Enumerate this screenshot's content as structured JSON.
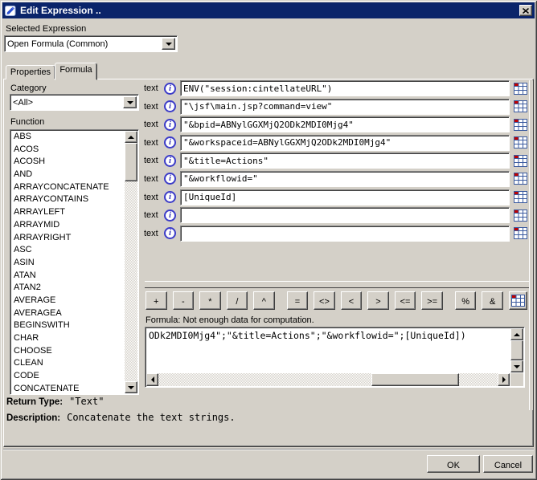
{
  "window": {
    "title": "Edit Expression .."
  },
  "selected_expression": {
    "label": "Selected Expression",
    "value": "Open Formula (Common)"
  },
  "tabs": {
    "properties": "Properties",
    "formula": "Formula"
  },
  "category": {
    "label": "Category",
    "value": "<All>"
  },
  "functions": {
    "label": "Function",
    "items": [
      "ABS",
      "ACOS",
      "ACOSH",
      "AND",
      "ARRAYCONCATENATE",
      "ARRAYCONTAINS",
      "ARRAYLEFT",
      "ARRAYMID",
      "ARRAYRIGHT",
      "ASC",
      "ASIN",
      "ATAN",
      "ATAN2",
      "AVERAGE",
      "AVERAGEA",
      "BEGINSWITH",
      "CHAR",
      "CHOOSE",
      "CLEAN",
      "CODE",
      "CONCATENATE"
    ]
  },
  "rows": [
    {
      "label": "text",
      "value": "ENV(\"session:cintellateURL\")"
    },
    {
      "label": "text",
      "value": "\"\\jsf\\main.jsp?command=view\""
    },
    {
      "label": "text",
      "value": "\"&bpid=ABNylGGXMjQ2ODk2MDI0Mjg4\""
    },
    {
      "label": "text",
      "value": "\"&workspaceid=ABNylGGXMjQ2ODk2MDI0Mjg4\""
    },
    {
      "label": "text",
      "value": "\"&title=Actions\""
    },
    {
      "label": "text",
      "value": "\"&workflowid=\""
    },
    {
      "label": "text",
      "value": "[UniqueId]"
    },
    {
      "label": "text",
      "value": ""
    },
    {
      "label": "text",
      "value": ""
    }
  ],
  "operators": [
    [
      "+",
      "-",
      "*",
      "/",
      "^"
    ],
    [
      "=",
      "<>",
      "<",
      ">",
      "<=",
      ">="
    ],
    [
      "%",
      "&"
    ]
  ],
  "formula": {
    "status": "Formula: Not enough data for computation.",
    "value": "ODk2MDI0Mjg4\";\"&title=Actions\";\"&workflowid=\";[UniqueId])"
  },
  "return_type": {
    "label": "Return Type:",
    "value": "\"Text\""
  },
  "description": {
    "label": "Description:",
    "value": "Concatenate the text strings."
  },
  "actions": {
    "ok": "OK",
    "cancel": "Cancel"
  },
  "colors": {
    "titlebar": "#0A246A",
    "dialog_bg": "#D4D0C8",
    "grid_icon_red": "#C00000",
    "grid_icon_blue": "#3A5A9F",
    "info_icon_blue": "#3C3CC8"
  }
}
